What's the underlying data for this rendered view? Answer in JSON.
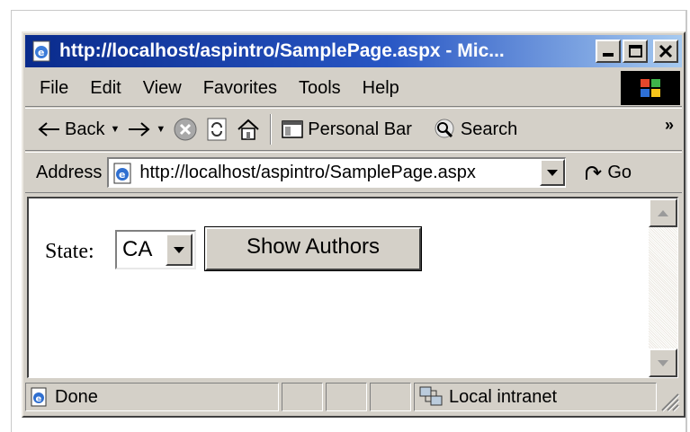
{
  "window": {
    "title": "http://localhost/aspintro/SamplePage.aspx - Mic..."
  },
  "menu": [
    "File",
    "Edit",
    "View",
    "Favorites",
    "Tools",
    "Help"
  ],
  "toolbar": {
    "back_label": "Back",
    "personal_bar_label": "Personal Bar",
    "search_label": "Search",
    "overflow": "»"
  },
  "address": {
    "label": "Address",
    "url": "http://localhost/aspintro/SamplePage.aspx",
    "go_label": "Go"
  },
  "page": {
    "state_label": "State:",
    "state_value": "CA",
    "show_button": "Show Authors"
  },
  "status": {
    "text": "Done",
    "zone": "Local intranet"
  },
  "colors": {
    "title_gradient_start": "#0a2b8c",
    "title_gradient_end": "#a6caf0",
    "chrome": "#d4d0c8"
  }
}
